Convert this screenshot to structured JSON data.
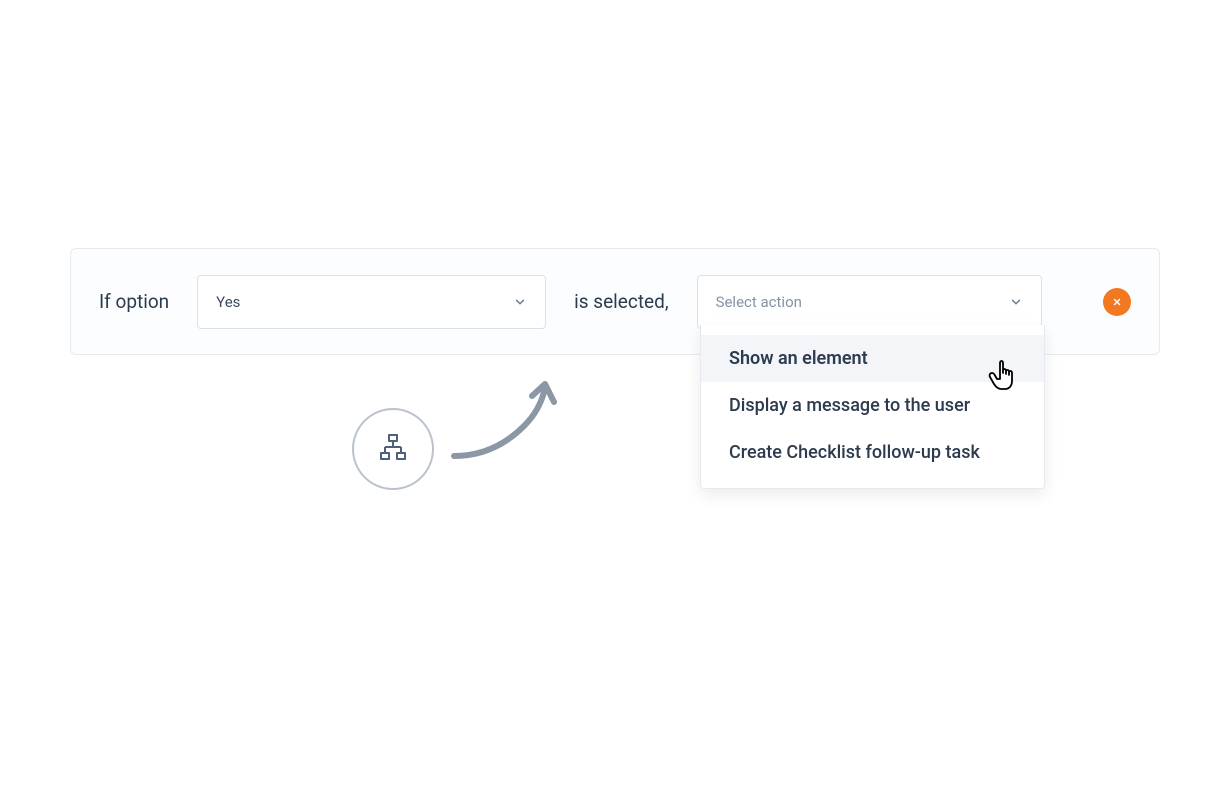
{
  "rule": {
    "prefix_label": "If option",
    "option_value": "Yes",
    "suffix_label": "is selected,",
    "action_placeholder": "Select action"
  },
  "dropdown": {
    "options": [
      "Show an element",
      "Display a message to the user",
      "Create Checklist follow-up task"
    ]
  },
  "colors": {
    "accent": "#f27921",
    "text_dark": "#2d3b4e",
    "text_muted": "#8494a7",
    "border": "#dbe1e8",
    "neutral": "#8b97a5"
  }
}
